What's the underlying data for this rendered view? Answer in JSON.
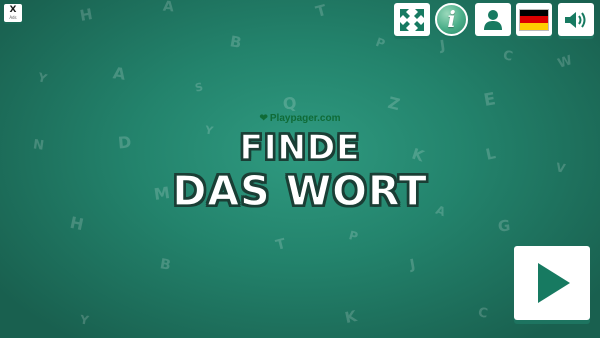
{
  "top_left_tile": {
    "label": "X",
    "sublabel": "Ads"
  },
  "toolbar": {
    "fullscreen": {
      "icon": "expand-arrows-icon"
    },
    "info": {
      "icon": "info-icon",
      "glyph": "i"
    },
    "profile": {
      "icon": "user-icon"
    },
    "language": {
      "icon": "german-flag-icon",
      "colors": [
        "#000000",
        "#dd0000",
        "#ffce00"
      ]
    },
    "sound": {
      "icon": "speaker-icon"
    }
  },
  "brand": {
    "heart": "❤",
    "name": "Playpager.com"
  },
  "title": {
    "line1": "FINDE",
    "line2": "DAS WORT"
  },
  "play_button": {
    "icon": "play-icon"
  },
  "background_letters": [
    "H",
    "A",
    "T",
    "B",
    "P",
    "J",
    "C",
    "W",
    "Y",
    "A",
    "S",
    "Y",
    "Q",
    "Z",
    "E",
    "N",
    "D",
    "K",
    "L",
    "V",
    "M",
    "H",
    "T",
    "A",
    "G",
    "P",
    "B",
    "J",
    "Y",
    "K",
    "C"
  ],
  "colors": {
    "background": "#23836c",
    "accent": "#177a61",
    "brand_text": "#0f6b37",
    "title_fill": "#ffffff",
    "title_outline": "#1a3e35"
  }
}
